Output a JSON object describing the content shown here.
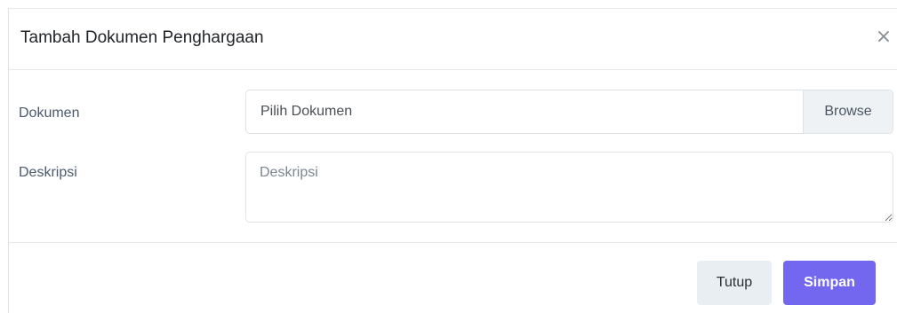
{
  "modal": {
    "title": "Tambah Dokumen Penghargaan",
    "close_symbol": "×"
  },
  "form": {
    "dokumen": {
      "label": "Dokumen",
      "file_label": "Pilih Dokumen",
      "browse_label": "Browse"
    },
    "deskripsi": {
      "label": "Deskripsi",
      "placeholder": "Deskripsi",
      "value": ""
    }
  },
  "footer": {
    "close_label": "Tutup",
    "save_label": "Simpan"
  },
  "colors": {
    "primary": "#7367f0",
    "secondary_button_bg": "#e9eef2",
    "label_text": "#495a6e"
  },
  "icons": {
    "close": "close-icon",
    "resize_handle": "resize-grip-icon"
  }
}
